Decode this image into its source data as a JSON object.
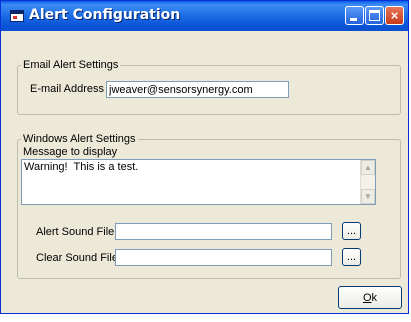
{
  "window": {
    "title": "Alert Configuration",
    "close_glyph": "×"
  },
  "email_group": {
    "legend": "Email Alert Settings",
    "email_label": "E-mail Address",
    "email_value": "jweaver@sensorsynergy.com"
  },
  "windows_group": {
    "legend": "Windows Alert Settings",
    "message_label": "Message to display",
    "message_value": "Warning!  This is a test.",
    "alert_sound_label": "Alert Sound File",
    "alert_sound_value": "",
    "clear_sound_label": "Clear Sound File",
    "clear_sound_value": "",
    "browse_label": "..."
  },
  "footer": {
    "ok_underlined": "O",
    "ok_rest": "k"
  },
  "icons": {
    "app": "alert-window-icon",
    "scroll_up": "▲",
    "scroll_down": "▼"
  },
  "colors": {
    "titlebar": "#0a55d8",
    "dialog_bg": "#ece9d8",
    "input_border": "#7f9db9",
    "button_border": "#003c74"
  }
}
